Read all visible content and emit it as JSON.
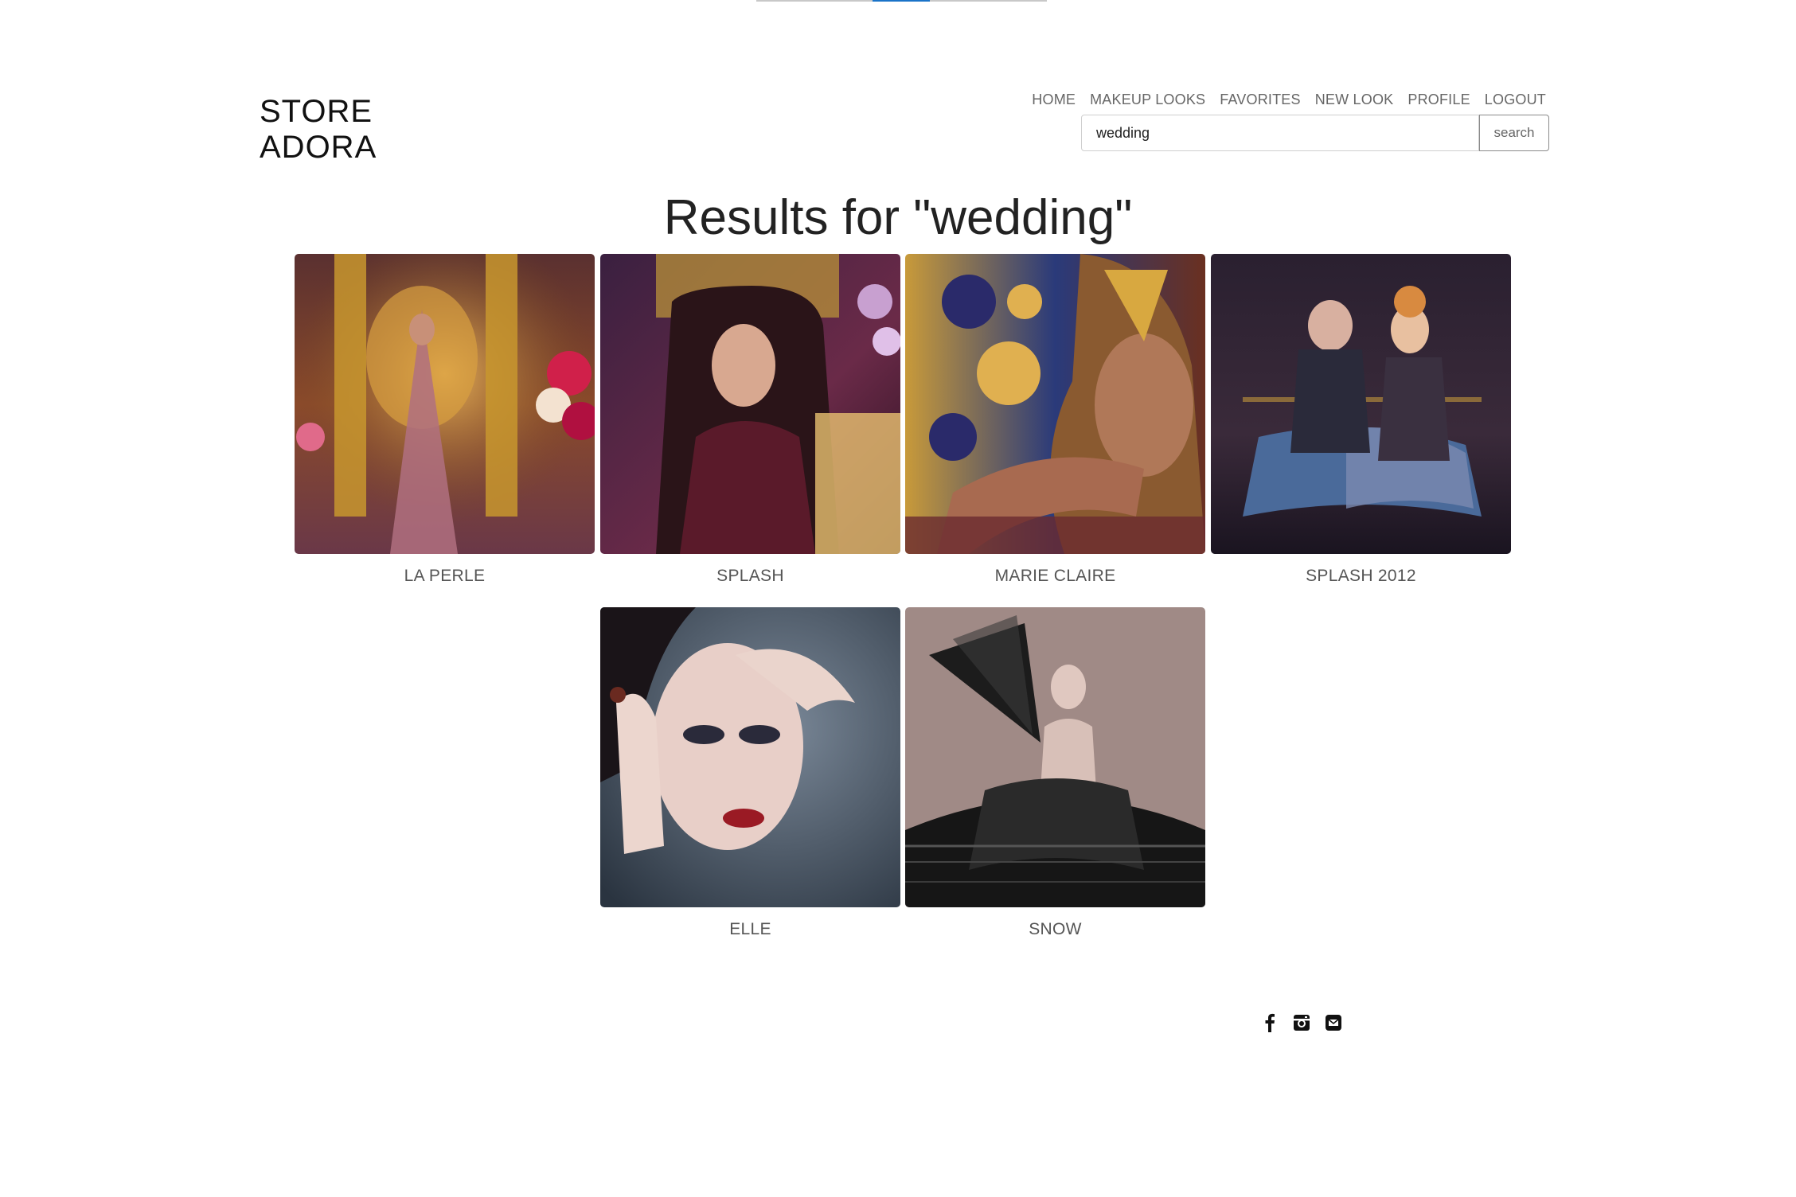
{
  "brand": {
    "line1": "STORE",
    "line2": "ADORA"
  },
  "nav": {
    "items": [
      {
        "label": "HOME"
      },
      {
        "label": "MAKEUP LOOKS"
      },
      {
        "label": "FAVORITES"
      },
      {
        "label": "NEW LOOK"
      },
      {
        "label": "PROFILE"
      },
      {
        "label": "LOGOUT"
      }
    ]
  },
  "search": {
    "value": "wedding",
    "button_label": "search"
  },
  "results": {
    "title": "Results for \"wedding\"",
    "items": [
      {
        "caption": "LA PERLE"
      },
      {
        "caption": "SPLASH"
      },
      {
        "caption": "MARIE CLAIRE"
      },
      {
        "caption": "SPLASH 2012"
      },
      {
        "caption": "ELLE"
      },
      {
        "caption": "SNOW"
      }
    ]
  },
  "footer": {
    "social": [
      "facebook-icon",
      "instagram-icon",
      "email-icon"
    ]
  },
  "colors": {
    "accent": "#1a73c8",
    "nav_text": "#666666",
    "caption_text": "#555555"
  }
}
